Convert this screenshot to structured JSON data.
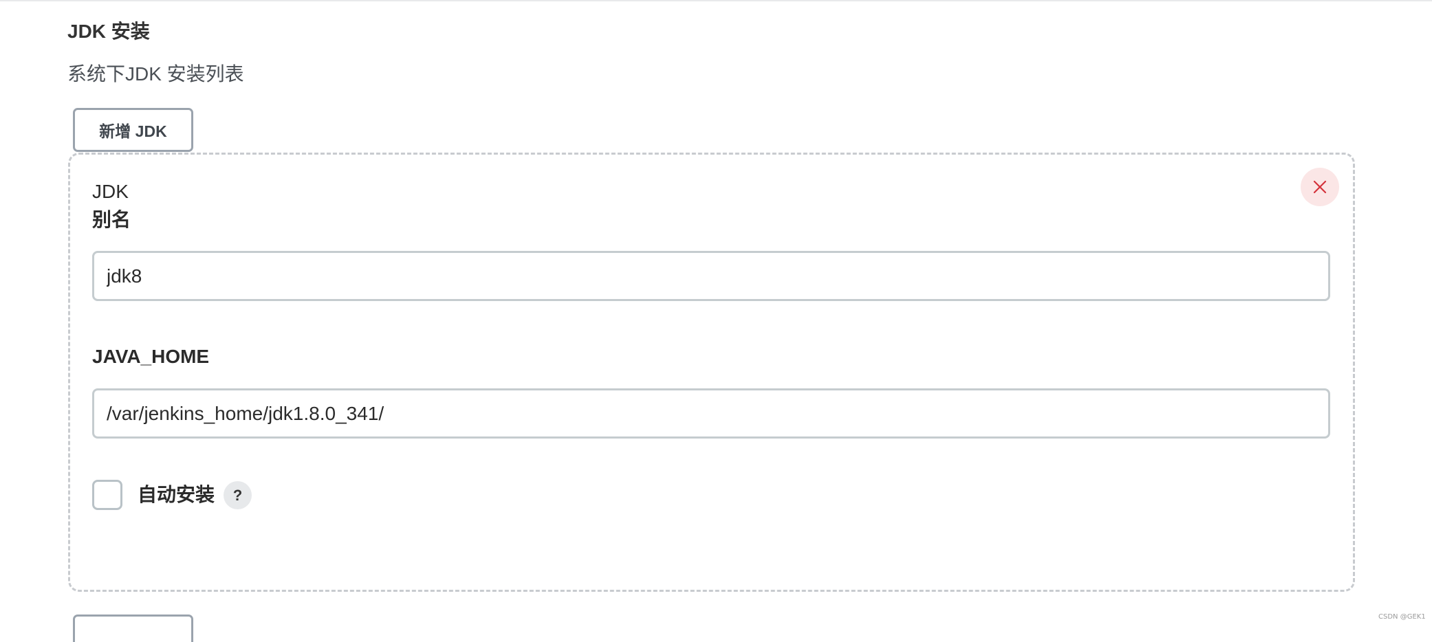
{
  "section": {
    "title": "JDK 安装",
    "description": "系统下JDK 安装列表",
    "add_button_label": "新增 JDK"
  },
  "jdk_entry": {
    "type_label": "JDK",
    "alias_label": "别名",
    "alias_value": "jdk8",
    "java_home_label": "JAVA_HOME",
    "java_home_value": "/var/jenkins_home/jdk1.8.0_341/",
    "auto_install_label": "自动安装",
    "auto_install_checked": false,
    "help_label": "?",
    "close_icon": "close-icon"
  },
  "watermark": "CSDN @GEK1",
  "colors": {
    "close_icon": "#d4323b",
    "close_bg": "#fbe6e6",
    "card_border": "#c8cbcf",
    "button_border": "#9aa3ad"
  }
}
